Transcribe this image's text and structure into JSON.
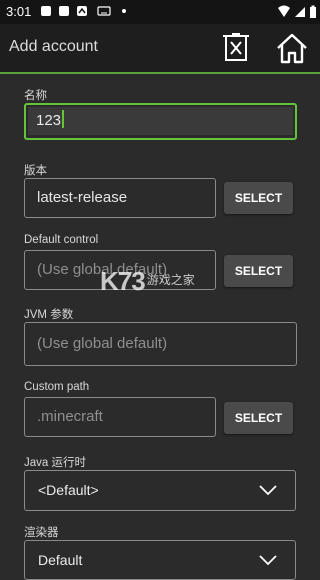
{
  "status": {
    "time": "3:01"
  },
  "appbar": {
    "title": "Add account",
    "delete_icon": "delete-box-icon",
    "home_icon": "home-icon"
  },
  "form": {
    "name": {
      "label": "名称",
      "value": "123"
    },
    "version": {
      "label": "版本",
      "value": "latest-release",
      "button": "SELECT"
    },
    "control": {
      "label": "Default control",
      "placeholder": "(Use global default)",
      "button": "SELECT"
    },
    "jvm": {
      "label": "JVM 参数",
      "placeholder": "(Use global default)"
    },
    "path": {
      "label": "Custom path",
      "placeholder": ".minecraft",
      "button": "SELECT"
    },
    "java": {
      "label": "Java 运行时",
      "value": "<Default>"
    },
    "renderer": {
      "label": "渲染器",
      "value": "Default"
    }
  },
  "watermark": {
    "text": "K73",
    "subtext": "游戏之家"
  },
  "colors": {
    "accent": "#63c43c",
    "background": "#2b2b2b",
    "appbar": "#1e1e1e"
  }
}
